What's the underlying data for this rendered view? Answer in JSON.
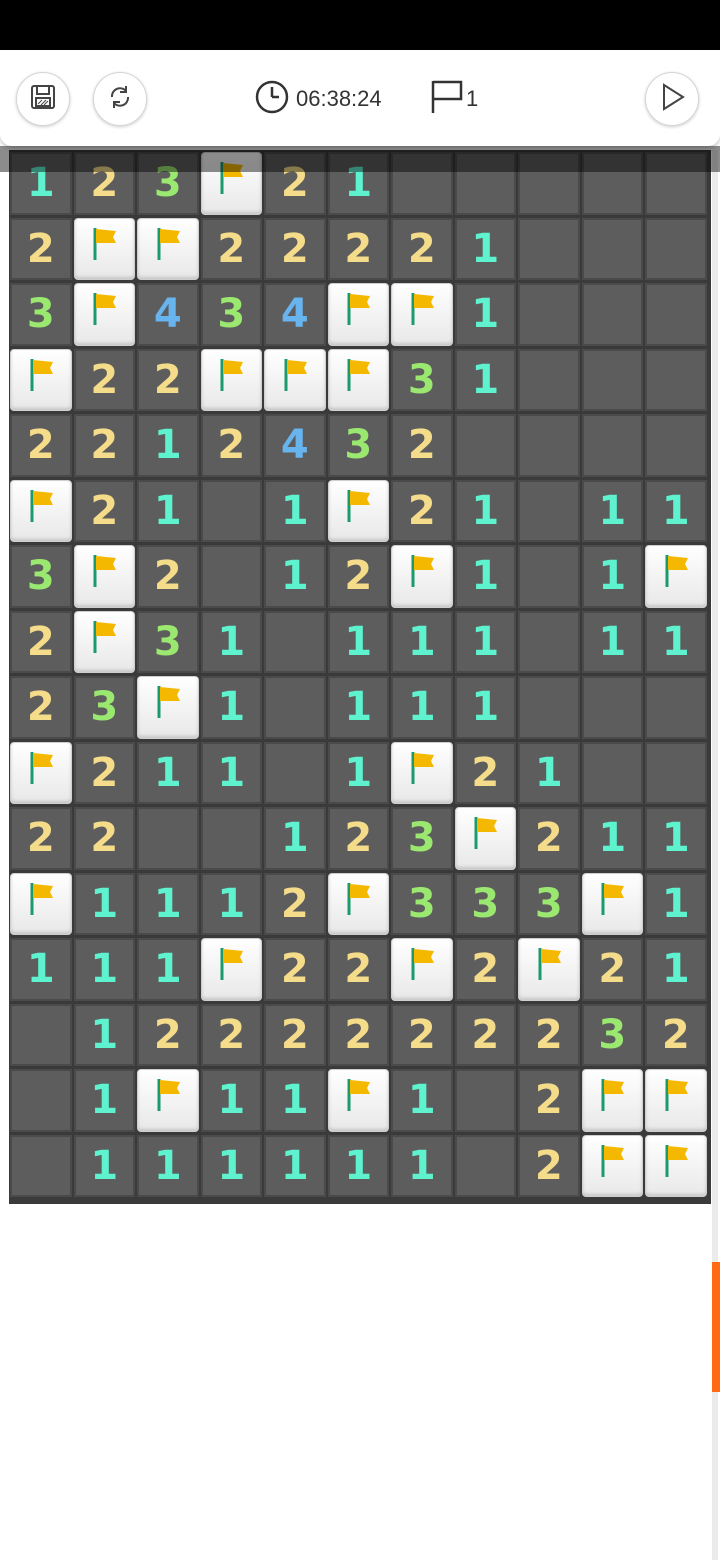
{
  "toolbar": {
    "timer": "06:38:24",
    "flag_count": "1",
    "icons": [
      "save-icon",
      "restart-icon",
      "clock-icon",
      "flag-outline-icon",
      "play-icon"
    ]
  },
  "colors": {
    "n1": "#5ff2cf",
    "n2": "#f4dc8a",
    "n3": "#9be870",
    "n4": "#67b4ef",
    "flag": "#f5b800",
    "pole": "#1b9b6b",
    "scroll_thumb": "#ff6a13"
  },
  "board": {
    "rows": [
      [
        "1",
        "2",
        "3",
        "F",
        "2",
        "1",
        "",
        "",
        "",
        "",
        ""
      ],
      [
        "2",
        "F",
        "F",
        "2",
        "2",
        "2",
        "2",
        "1",
        "",
        "",
        ""
      ],
      [
        "3",
        "F",
        "4",
        "3",
        "4",
        "F",
        "F",
        "1",
        "",
        "",
        ""
      ],
      [
        "F",
        "2",
        "2",
        "F",
        "F",
        "F",
        "3",
        "1",
        "",
        "",
        ""
      ],
      [
        "2",
        "2",
        "1",
        "2",
        "4",
        "3",
        "2",
        "",
        "",
        "",
        ""
      ],
      [
        "F",
        "2",
        "1",
        "",
        "1",
        "F",
        "2",
        "1",
        "",
        "1",
        "1"
      ],
      [
        "3",
        "F",
        "2",
        "",
        "1",
        "2",
        "F",
        "1",
        "",
        "1",
        "F"
      ],
      [
        "2",
        "F",
        "3",
        "1",
        "",
        "1",
        "1",
        "1",
        "",
        "1",
        "1"
      ],
      [
        "2",
        "3",
        "F",
        "1",
        "",
        "1",
        "1",
        "1",
        "",
        "",
        ""
      ],
      [
        "F",
        "2",
        "1",
        "1",
        "",
        "1",
        "F",
        "2",
        "1",
        "",
        ""
      ],
      [
        "2",
        "2",
        "",
        "",
        "1",
        "2",
        "3",
        "F",
        "2",
        "1",
        "1"
      ],
      [
        "F",
        "1",
        "1",
        "1",
        "2",
        "F",
        "3",
        "3",
        "3",
        "F",
        "1"
      ],
      [
        "1",
        "1",
        "1",
        "F",
        "2",
        "2",
        "F",
        "2",
        "F",
        "2",
        "1"
      ],
      [
        "",
        "1",
        "2",
        "2",
        "2",
        "2",
        "2",
        "2",
        "2",
        "3",
        "2"
      ],
      [
        "",
        "1",
        "F",
        "1",
        "1",
        "F",
        "1",
        "",
        "2",
        "F",
        "F"
      ],
      [
        "",
        "1",
        "1",
        "1",
        "1",
        "1",
        "1",
        "",
        "2",
        "F",
        "F"
      ]
    ]
  }
}
